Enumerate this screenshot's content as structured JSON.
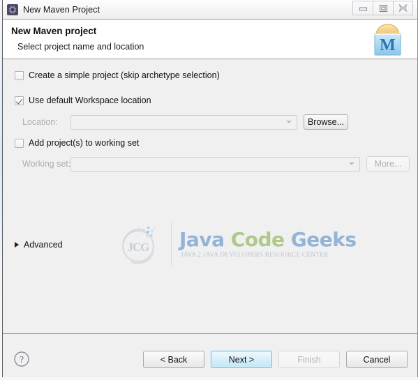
{
  "window": {
    "title": "New Maven Project",
    "icon": "maven-gear-icon",
    "controls": {
      "minimize": "minimize-icon",
      "maximize": "maximize-icon",
      "close": "close-icon"
    }
  },
  "wizard": {
    "title": "New Maven project",
    "subtitle": "Select project name and location",
    "banner_icon": "maven-logo-icon"
  },
  "form": {
    "simple_project": {
      "label": "Create a simple project (skip archetype selection)",
      "checked": false
    },
    "default_workspace": {
      "label": "Use default Workspace location",
      "checked": true
    },
    "location": {
      "label": "Location:",
      "value": "",
      "placeholder": "",
      "enabled": false,
      "browse_label": "Browse..."
    },
    "add_working_set": {
      "label": "Add project(s) to working set",
      "checked": false
    },
    "working_set": {
      "label": "Working set:",
      "value": "",
      "placeholder": "",
      "enabled": false,
      "more_label": "More..."
    },
    "advanced": {
      "label": "Advanced",
      "expanded": false
    }
  },
  "watermark": {
    "mark": "jcg-logo-icon",
    "title_part1": "Java ",
    "title_part2": "Code ",
    "title_part3": "Geeks",
    "tagline": "JAVA 2 JAVA DEVELOPERS RESOURCE CENTER"
  },
  "footer": {
    "help": "help-icon",
    "back_label": "< Back",
    "next_label": "Next >",
    "finish_label": "Finish",
    "cancel_label": "Cancel"
  },
  "colors": {
    "accent": "#3ab4e0",
    "window_bg": "#f0f0f0",
    "header_bg": "#ffffff",
    "wm_blue": "#5b8fc9",
    "wm_green": "#86b24a"
  }
}
